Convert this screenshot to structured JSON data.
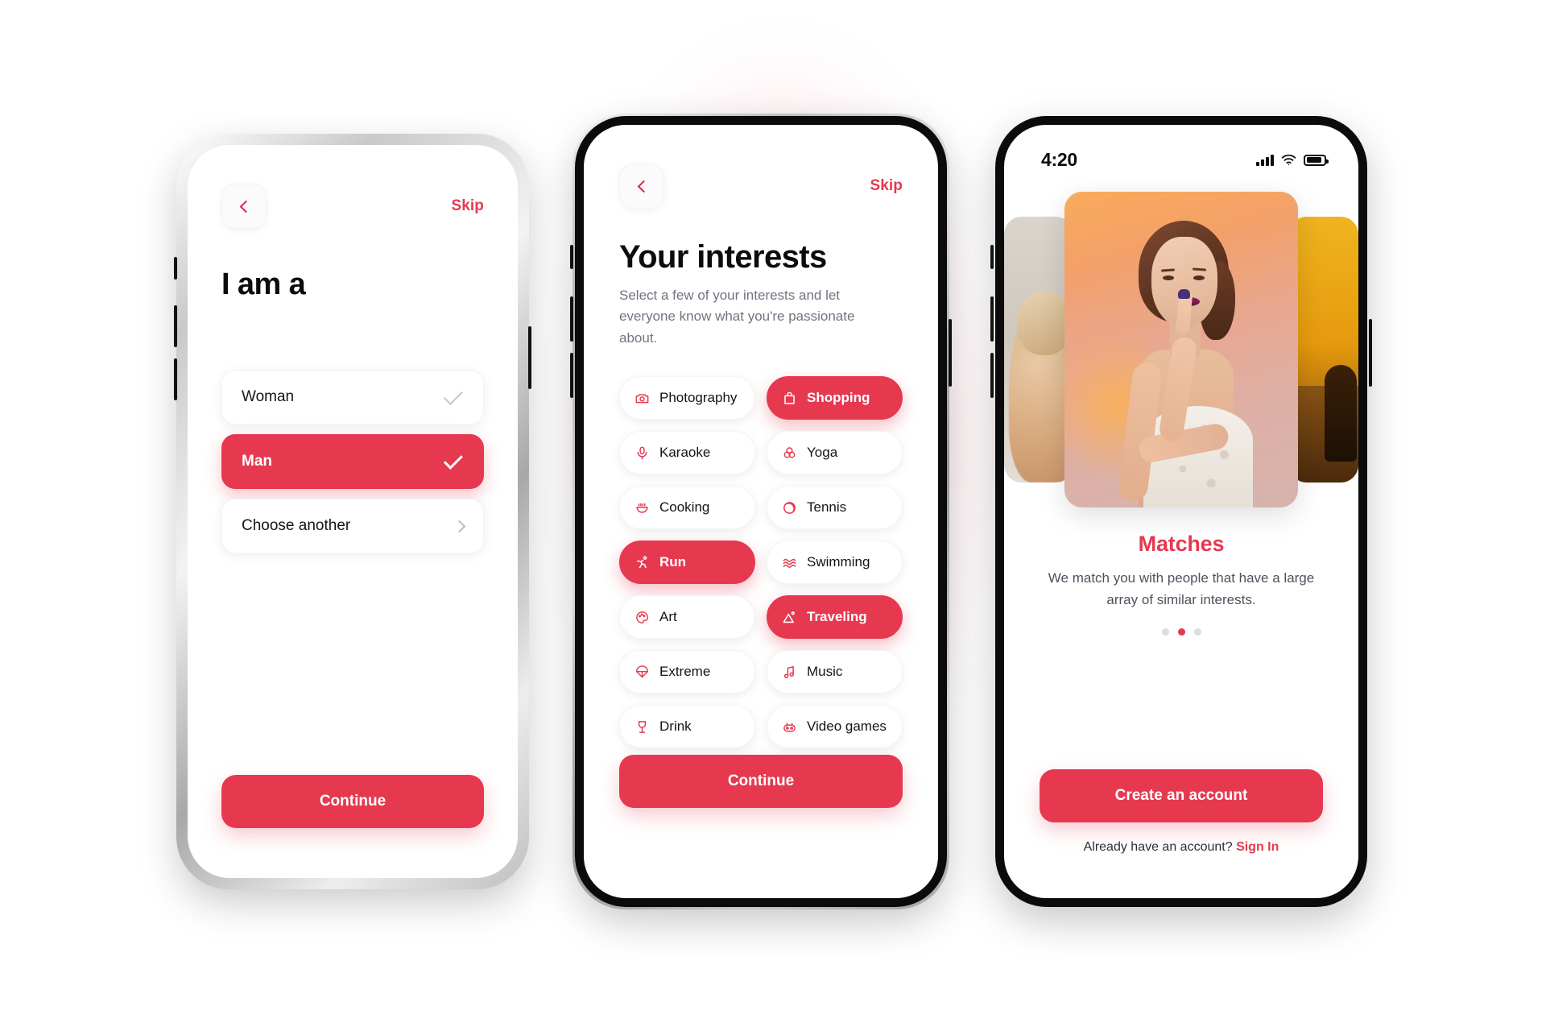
{
  "theme": {
    "accent": "#e63950",
    "accent_dark": "#e0244a",
    "text_dark": "#0c0c0c",
    "text_muted": "#6f7480",
    "page_bg": "#ffffff"
  },
  "screen_gender": {
    "back_icon": "chevron-left-icon",
    "skip_label": "Skip",
    "title": "I am a",
    "options": [
      {
        "label": "Woman",
        "selected": false,
        "accessory": "check-icon"
      },
      {
        "label": "Man",
        "selected": true,
        "accessory": "check-icon"
      },
      {
        "label": "Choose another",
        "selected": false,
        "accessory": "chevron-right-icon"
      }
    ],
    "continue_label": "Continue"
  },
  "screen_interests": {
    "back_icon": "chevron-left-icon",
    "skip_label": "Skip",
    "title": "Your interests",
    "subtitle": "Select a few of your interests and let everyone know what you're passionate about.",
    "tags": [
      {
        "label": "Photography",
        "icon": "camera-icon",
        "selected": false
      },
      {
        "label": "Shopping",
        "icon": "shopping-bag-icon",
        "selected": true
      },
      {
        "label": "Karaoke",
        "icon": "microphone-icon",
        "selected": false
      },
      {
        "label": "Yoga",
        "icon": "yoga-icon",
        "selected": false
      },
      {
        "label": "Cooking",
        "icon": "cooking-pot-icon",
        "selected": false
      },
      {
        "label": "Tennis",
        "icon": "tennis-ball-icon",
        "selected": false
      },
      {
        "label": "Run",
        "icon": "running-icon",
        "selected": true
      },
      {
        "label": "Swimming",
        "icon": "waves-icon",
        "selected": false
      },
      {
        "label": "Art",
        "icon": "palette-icon",
        "selected": false
      },
      {
        "label": "Traveling",
        "icon": "mountain-icon",
        "selected": true
      },
      {
        "label": "Extreme",
        "icon": "parachute-icon",
        "selected": false
      },
      {
        "label": "Music",
        "icon": "music-note-icon",
        "selected": false
      },
      {
        "label": "Drink",
        "icon": "wine-glass-icon",
        "selected": false
      },
      {
        "label": "Video games",
        "icon": "game-robot-icon",
        "selected": false
      }
    ],
    "continue_label": "Continue"
  },
  "screen_matches": {
    "status_bar": {
      "time": "4:20",
      "signal_icon": "signal-bars-icon",
      "wifi_icon": "wifi-icon",
      "battery_icon": "battery-icon"
    },
    "title": "Matches",
    "subtitle": "We match you with people that have a large array of similar interests.",
    "pagination": {
      "total": 3,
      "active_index": 1
    },
    "primary_button": "Create an account",
    "footer_text": "Already have an account?",
    "footer_link": "Sign In"
  }
}
